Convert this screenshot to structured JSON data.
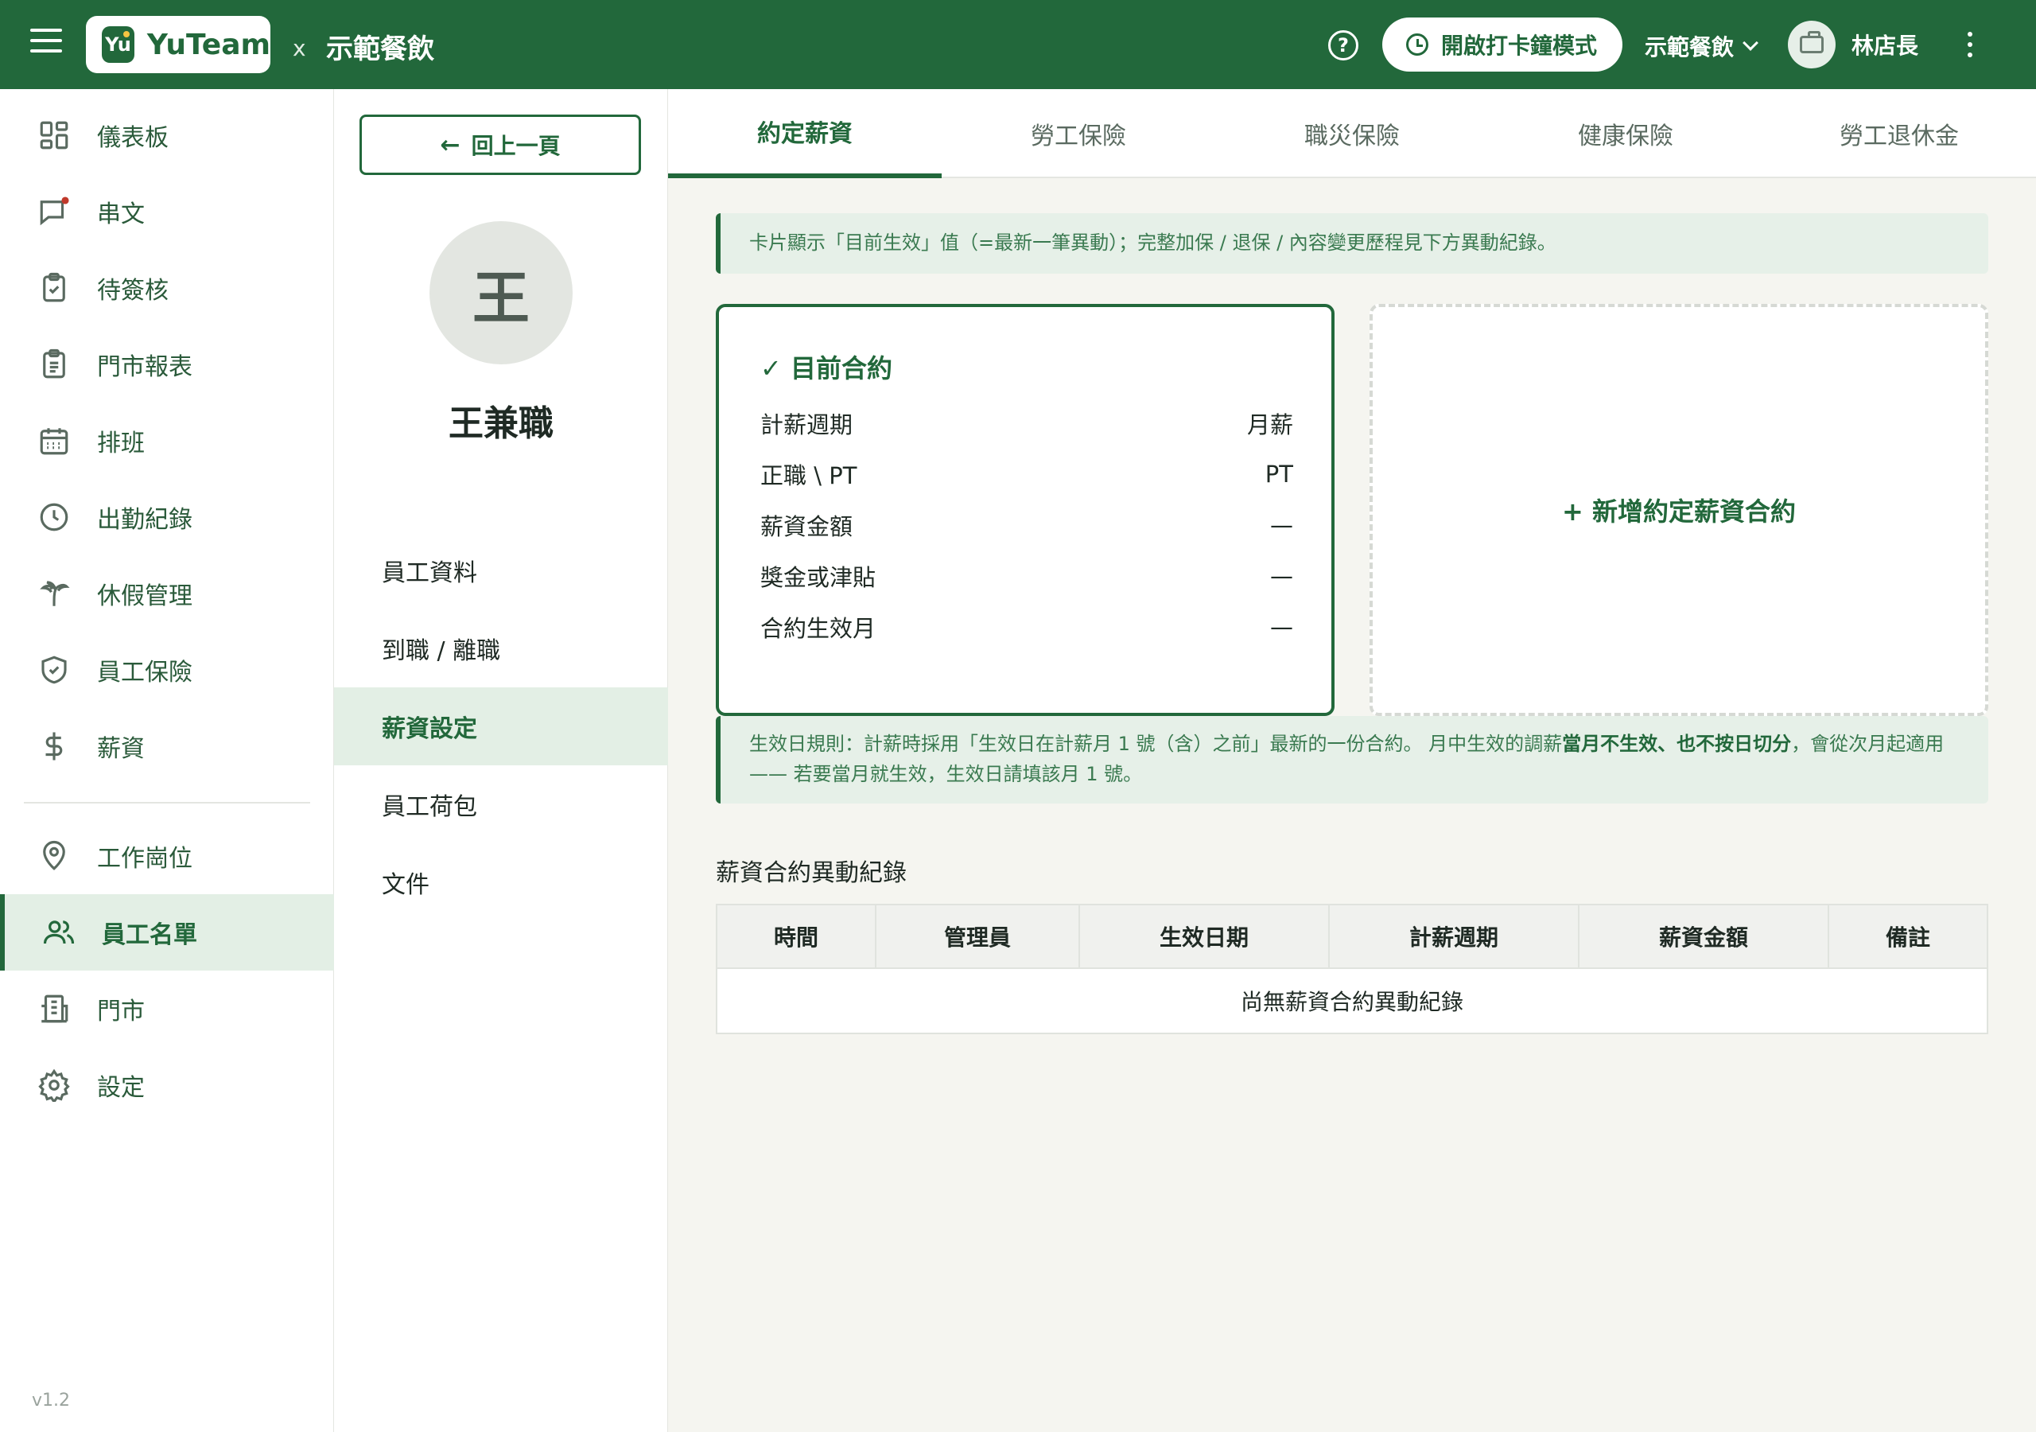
{
  "header": {
    "app_name": "YuTeam",
    "logo_mark": "Yu",
    "separator": "x",
    "shop_name": "示範餐飲",
    "help_icon": "?",
    "clock_button": "開啟打卡鐘模式",
    "shop_select": "示範餐飲",
    "user_name": "林店長"
  },
  "sidebar": {
    "items": [
      {
        "label": "儀表板",
        "icon": "dashboard-icon"
      },
      {
        "label": "串文",
        "icon": "chat-icon"
      },
      {
        "label": "待簽核",
        "icon": "clipboard-check-icon"
      },
      {
        "label": "門市報表",
        "icon": "report-icon"
      },
      {
        "label": "排班",
        "icon": "calendar-icon"
      },
      {
        "label": "出勤紀錄",
        "icon": "clock-icon"
      },
      {
        "label": "休假管理",
        "icon": "palm-tree-icon"
      },
      {
        "label": "員工保險",
        "icon": "shield-icon"
      },
      {
        "label": "薪資",
        "icon": "dollar-icon"
      },
      {
        "label": "工作崗位",
        "icon": "location-icon"
      },
      {
        "label": "員工名單",
        "icon": "users-icon"
      },
      {
        "label": "門市",
        "icon": "building-icon"
      },
      {
        "label": "設定",
        "icon": "gear-icon"
      }
    ],
    "version": "v1.2"
  },
  "panel": {
    "back_label": "回上一頁",
    "avatar_initial": "王",
    "employee_name": "王兼職",
    "items": [
      "員工資料",
      "到職 / 離職",
      "薪資設定",
      "員工荷包",
      "文件"
    ]
  },
  "tabs": [
    "約定薪資",
    "勞工保險",
    "職災保險",
    "健康保險",
    "勞工退休金"
  ],
  "notice_top": "卡片顯示「目前生效」值（=最新一筆異動）；完整加保 / 退保 / 內容變更歷程見下方異動紀錄。",
  "contract": {
    "title": "✓ 目前合約",
    "rows": [
      {
        "label": "計薪週期",
        "value": "月薪"
      },
      {
        "label": "正職 \\ PT",
        "value": "PT"
      },
      {
        "label": "薪資金額",
        "value": "—"
      },
      {
        "label": "獎金或津貼",
        "value": "—"
      },
      {
        "label": "合約生效月",
        "value": "—"
      }
    ]
  },
  "add_contract_label": "+ 新增約定薪資合約",
  "rule_notice": {
    "part1": "生效日規則：計薪時採用「生效日在計薪月 1 號（含）之前」最新的一份合約。 月中生效的調薪",
    "bold": "當月不生效、也不按日切分",
    "part2": "，會從次月起適用—— 若要當月就生效，生效日請填該月 1 號。"
  },
  "log": {
    "title": "薪資合約異動紀錄",
    "columns": [
      "時間",
      "管理員",
      "生效日期",
      "計薪週期",
      "薪資金額",
      "備註"
    ],
    "empty": "尚無薪資合約異動紀錄"
  },
  "colors": {
    "brand": "#22683b",
    "active_bg": "#e3efe5",
    "notice_bg": "#e6f0e8"
  }
}
